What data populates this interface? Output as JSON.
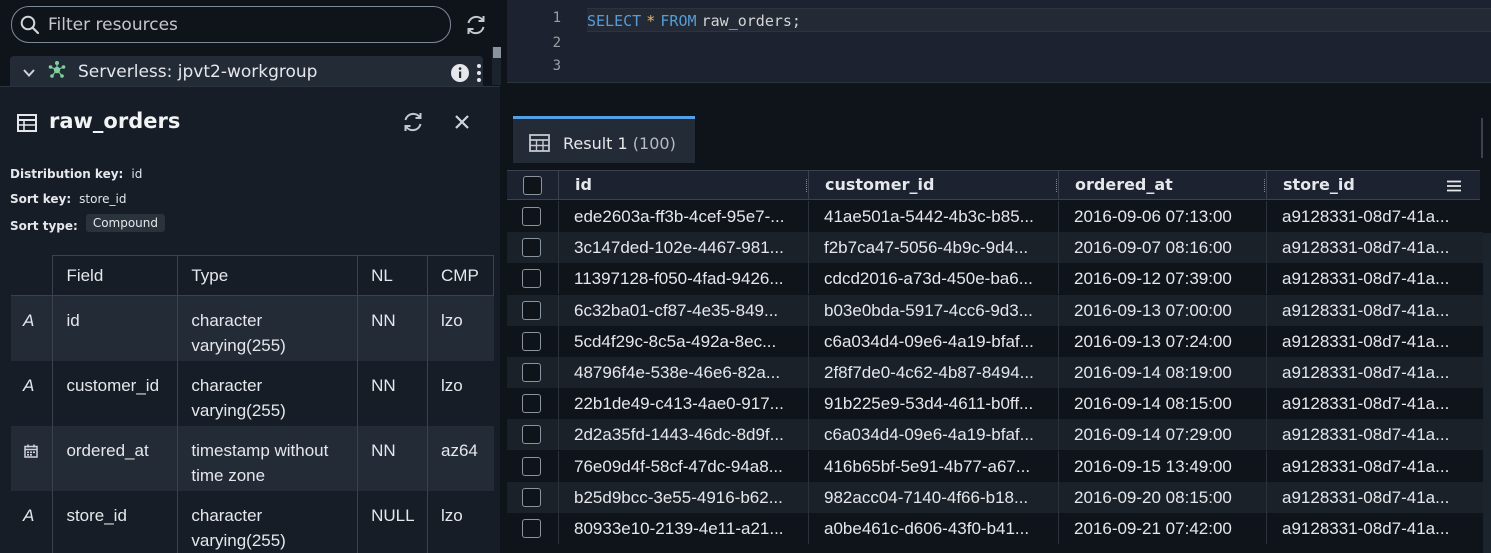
{
  "sidebar": {
    "search_placeholder": "Filter resources",
    "workgroup_label": "Serverless: jpvt2-workgroup"
  },
  "table_details": {
    "title": "raw_orders",
    "distribution_key_label": "Distribution key:",
    "distribution_key": "id",
    "sort_key_label": "Sort key:",
    "sort_key": "store_id",
    "sort_type_label": "Sort type:",
    "sort_type": "Compound",
    "columns": [
      "Field",
      "Type",
      "NL",
      "CMP"
    ],
    "fields": [
      {
        "type_icon": "A",
        "name": "id",
        "type_line1": "character",
        "type_line2": "varying(255)",
        "nl": "NN",
        "cmp": "lzo"
      },
      {
        "type_icon": "A",
        "name": "customer_id",
        "type_line1": "character",
        "type_line2": "varying(255)",
        "nl": "NN",
        "cmp": "lzo"
      },
      {
        "type_icon": "calendar-icon",
        "name": "ordered_at",
        "type_line1": "timestamp without",
        "type_line2": "time zone",
        "nl": "NN",
        "cmp": "az64"
      },
      {
        "type_icon": "A",
        "name": "store_id",
        "type_line1": "character",
        "type_line2": "varying(255)",
        "nl": "NULL",
        "cmp": "lzo"
      }
    ]
  },
  "editor": {
    "line_numbers": [
      "1",
      "2",
      "3"
    ],
    "code": {
      "kw1": "SELECT",
      "op": "*",
      "kw2": "FROM",
      "rest": "raw_orders;"
    }
  },
  "results": {
    "tab_label": "Result 1",
    "tab_count": "(100)",
    "columns": [
      "id",
      "customer_id",
      "ordered_at",
      "store_id"
    ],
    "rows": [
      [
        "ede2603a-ff3b-4cef-95e7-...",
        "41ae501a-5442-4b3c-b85...",
        "2016-09-06 07:13:00",
        "a9128331-08d7-41a..."
      ],
      [
        "3c147ded-102e-4467-981...",
        "f2b7ca47-5056-4b9c-9d4...",
        "2016-09-07 08:16:00",
        "a9128331-08d7-41a..."
      ],
      [
        "11397128-f050-4fad-9426...",
        "cdcd2016-a73d-450e-ba6...",
        "2016-09-12 07:39:00",
        "a9128331-08d7-41a..."
      ],
      [
        "6c32ba01-cf87-4e35-849...",
        "b03e0bda-5917-4cc6-9d3...",
        "2016-09-13 07:00:00",
        "a9128331-08d7-41a..."
      ],
      [
        "5cd4f29c-8c5a-492a-8ec...",
        "c6a034d4-09e6-4a19-bfaf...",
        "2016-09-13 07:24:00",
        "a9128331-08d7-41a..."
      ],
      [
        "48796f4e-538e-46e6-82a...",
        "2f8f7de0-4c62-4b87-8494...",
        "2016-09-14 08:19:00",
        "a9128331-08d7-41a..."
      ],
      [
        "22b1de49-c413-4ae0-917...",
        "91b225e9-53d4-4611-b0ff...",
        "2016-09-14 08:15:00",
        "a9128331-08d7-41a..."
      ],
      [
        "2d2a35fd-1443-46dc-8d9f...",
        "c6a034d4-09e6-4a19-bfaf...",
        "2016-09-14 07:29:00",
        "a9128331-08d7-41a..."
      ],
      [
        "76e09d4f-58cf-47dc-94a8...",
        "416b65bf-5e91-4b77-a67...",
        "2016-09-15 13:49:00",
        "a9128331-08d7-41a..."
      ],
      [
        "b25d9bcc-3e55-4916-b62...",
        "982acc04-7140-4f66-b18...",
        "2016-09-20 08:15:00",
        "a9128331-08d7-41a..."
      ],
      [
        "80933e10-2139-4e11-a21...",
        "a0be461c-d606-43f0-b41...",
        "2016-09-21 07:42:00",
        "a9128331-08d7-41a..."
      ]
    ]
  },
  "colors": {
    "tab_accent": "#539fe5",
    "keyword": "#569cd6",
    "operator": "#e8b963",
    "workgroup_icon": "#7fd1a0"
  }
}
